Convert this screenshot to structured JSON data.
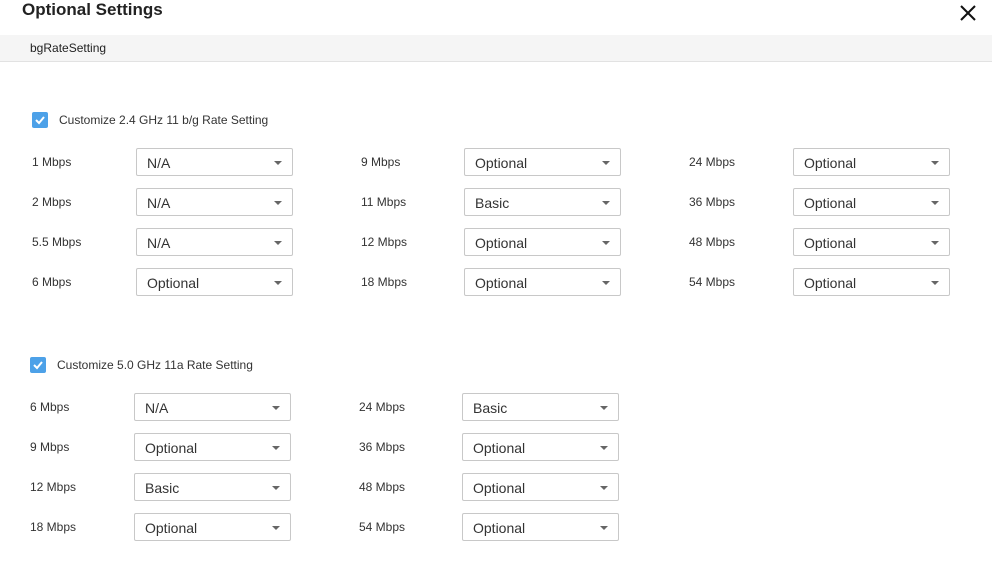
{
  "dialog": {
    "title": "Optional Settings"
  },
  "tab": {
    "label": "bgRateSetting"
  },
  "section24": {
    "label": "Customize 2.4 GHz 11 b/g Rate Setting",
    "checked": true,
    "rows": [
      {
        "label": "1 Mbps",
        "value": "N/A"
      },
      {
        "label": "2 Mbps",
        "value": "N/A"
      },
      {
        "label": "5.5 Mbps",
        "value": "N/A"
      },
      {
        "label": "6 Mbps",
        "value": "Optional"
      },
      {
        "label": "9 Mbps",
        "value": "Optional"
      },
      {
        "label": "11 Mbps",
        "value": "Basic"
      },
      {
        "label": "12 Mbps",
        "value": "Optional"
      },
      {
        "label": "18 Mbps",
        "value": "Optional"
      },
      {
        "label": "24 Mbps",
        "value": "Optional"
      },
      {
        "label": "36 Mbps",
        "value": "Optional"
      },
      {
        "label": "48 Mbps",
        "value": "Optional"
      },
      {
        "label": "54 Mbps",
        "value": "Optional"
      }
    ]
  },
  "section50": {
    "label": "Customize 5.0 GHz 11a Rate Setting",
    "checked": true,
    "rows": [
      {
        "label": "6 Mbps",
        "value": "N/A"
      },
      {
        "label": "9 Mbps",
        "value": "Optional"
      },
      {
        "label": "12 Mbps",
        "value": "Basic"
      },
      {
        "label": "18 Mbps",
        "value": "Optional"
      },
      {
        "label": "24 Mbps",
        "value": "Basic"
      },
      {
        "label": "36 Mbps",
        "value": "Optional"
      },
      {
        "label": "48 Mbps",
        "value": "Optional"
      },
      {
        "label": "54 Mbps",
        "value": "Optional"
      }
    ]
  },
  "icons": {
    "close": "close-icon",
    "checkbox": "checkmark-icon",
    "dropdown": "chevron-down-icon"
  },
  "colors": {
    "checkbox": "#4da1e8",
    "tabbar": "#f5f5f5"
  }
}
